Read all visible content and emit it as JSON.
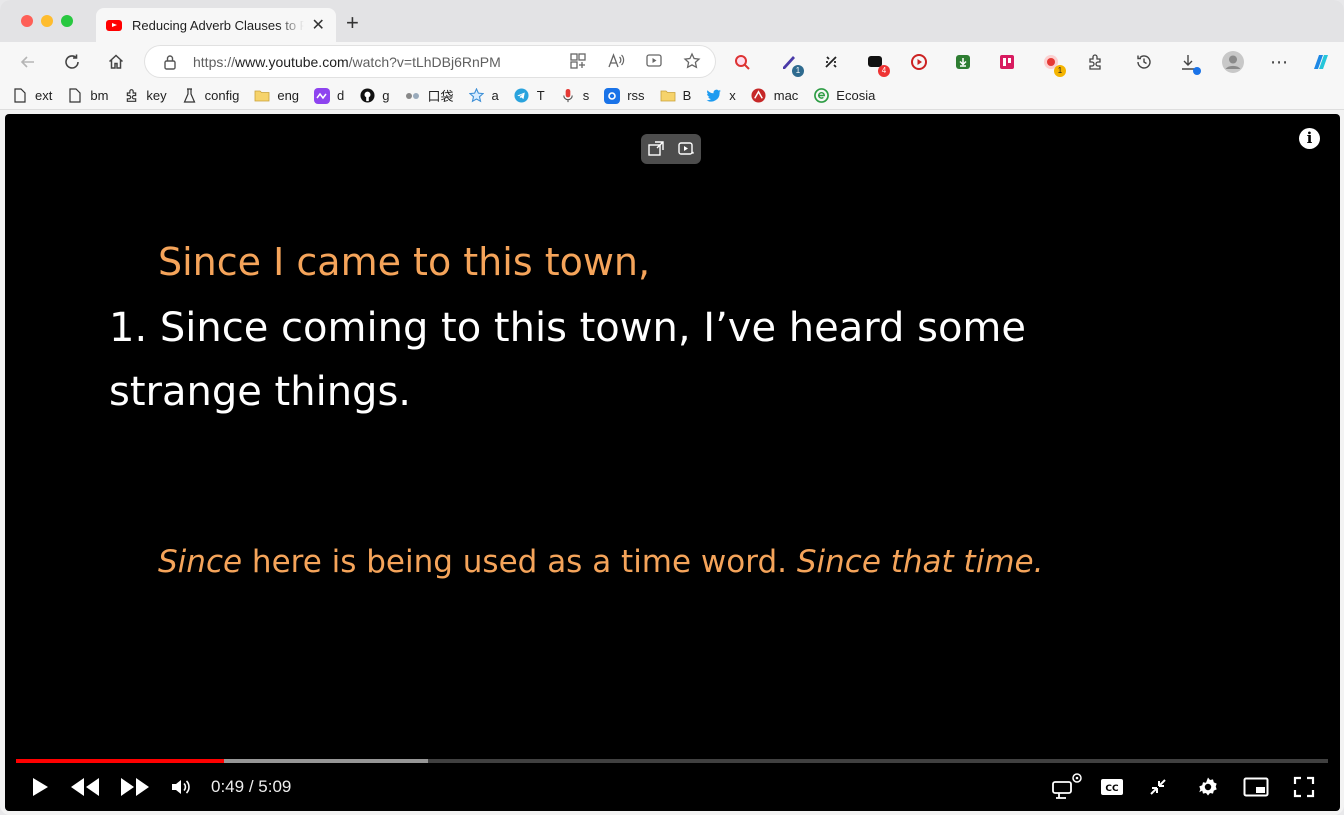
{
  "tab": {
    "title": "Reducing Adverb Clauses to Phrases",
    "close_label": "✕",
    "new_tab_label": "+"
  },
  "address_bar": {
    "url_prefix": "https://",
    "url_host": "www.youtube.com",
    "url_path": "/watch?v=tLhDBj6RnPM"
  },
  "toolbar": {
    "extensions": [
      {
        "name": "search-lens-ext",
        "color": "#d33"
      },
      {
        "name": "notes-ext",
        "color": "#4a3aa8",
        "badge": "1",
        "badge_color": "#2f6b8f"
      },
      {
        "name": "sparkle-ext",
        "color": "#222"
      },
      {
        "name": "chat-ext",
        "color": "#111",
        "badge": "4",
        "badge_color": "#e33"
      },
      {
        "name": "media-ext",
        "color": "#c22"
      },
      {
        "name": "download-helper-ext",
        "color": "#2e7d32"
      },
      {
        "name": "board-ext",
        "color": "#d81b60"
      },
      {
        "name": "record-ext",
        "color": "#e53935",
        "badge": "1",
        "badge_color": "#f4b400"
      }
    ],
    "downloads_badge_color": "#1a73e8"
  },
  "bookmarks": [
    {
      "label": "ext",
      "icon": "page-icon"
    },
    {
      "label": "bm",
      "icon": "page-icon"
    },
    {
      "label": "key",
      "icon": "puzzle-icon"
    },
    {
      "label": "config",
      "icon": "flask-icon"
    },
    {
      "label": "eng",
      "icon": "folder-icon"
    },
    {
      "label": "d",
      "icon": "purple-app-icon"
    },
    {
      "label": "g",
      "icon": "github-icon"
    },
    {
      "label": "口袋",
      "icon": "pocket-icon"
    },
    {
      "label": "a",
      "icon": "star-icon"
    },
    {
      "label": "T",
      "icon": "telegram-icon"
    },
    {
      "label": "s",
      "icon": "mic-icon"
    },
    {
      "label": "rss",
      "icon": "rss-icon"
    },
    {
      "label": "B",
      "icon": "folder-icon"
    },
    {
      "label": "x",
      "icon": "twitter-icon"
    },
    {
      "label": "mac",
      "icon": "mac-icon"
    },
    {
      "label": "Ecosia",
      "icon": "ecosia-icon"
    }
  ],
  "video": {
    "line1": "Since I came to this town,",
    "line2": "1. Since coming to this town, I’ve heard some",
    "line3": "strange things.",
    "line4_italic_a": "Since",
    "line4_plain": " here is being used as a time word. ",
    "line4_italic_b": "Since that time.",
    "info_label": "i"
  },
  "player": {
    "current_time": "0:49",
    "separator": " / ",
    "duration": "5:09",
    "played_fraction": 0.1584,
    "buffered_fraction": 0.3143,
    "accent_color": "#ff0000"
  }
}
